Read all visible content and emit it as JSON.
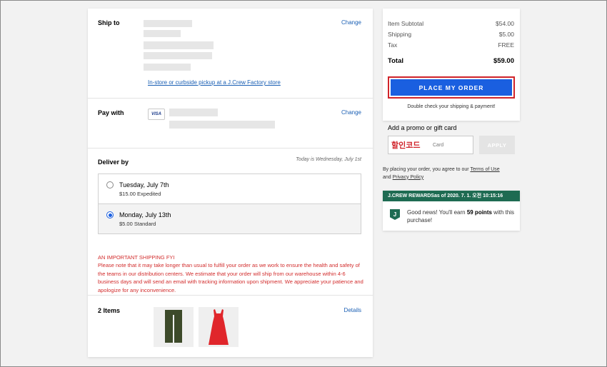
{
  "ship_to": {
    "title": "Ship to",
    "change_label": "Change",
    "pickup_link": "In-store or curbside pickup at a J.Crew Factory store"
  },
  "pay_with": {
    "title": "Pay with",
    "card_brand": "VISA",
    "change_label": "Change"
  },
  "deliver_by": {
    "title": "Deliver by",
    "today_note": "Today is Wednesday, July 1st",
    "options": [
      {
        "date": "Tuesday, July 7th",
        "detail": "$15.00 Expedited",
        "selected": false
      },
      {
        "date": "Monday, July 13th",
        "detail": "$5.00 Standard",
        "selected": true
      }
    ],
    "notice_title": "AN IMPORTANT SHIPPING FYI",
    "notice_body": "Please note that it may take longer than usual to fulfill your order as we work to ensure the health and safety of the teams in our distribution centers. We estimate that your order will ship from our warehouse within 4-6 business days and will send an email with tracking information upon shipment. We appreciate your patience and apologize for any inconvenience."
  },
  "items": {
    "title": "2 Items",
    "details_label": "Details",
    "thumbnails": [
      {
        "icon": "olive-pants-icon",
        "color": "#3d4a2a"
      },
      {
        "icon": "red-dress-icon",
        "color": "#e0262b"
      }
    ]
  },
  "summary": {
    "rows": [
      {
        "label": "Item Subtotal",
        "value": "$54.00"
      },
      {
        "label": "Shipping",
        "value": "$5.00"
      },
      {
        "label": "Tax",
        "value": "FREE"
      }
    ],
    "total_label": "Total",
    "total_value": "$59.00",
    "place_order_label": "PLACE MY ORDER",
    "double_check": "Double check your shipping & payment!"
  },
  "promo": {
    "title": "Add a promo or gift card",
    "placeholder_fragment": "Card",
    "korean_overlay": "할인코드",
    "apply_label": "APPLY"
  },
  "agreement": {
    "prefix": "By placing your order, you agree to our ",
    "terms_link": "Terms of Use",
    "and_text": "and ",
    "privacy_link": "Privacy Policy"
  },
  "rewards": {
    "header": "J.CREW REWARDSas of 2020. 7. 1. 오전 10:15:16",
    "logo_letter": "J",
    "text_prefix": "Good news! You'll earn ",
    "points": "59 points",
    "text_suffix": " with this purchase!"
  },
  "colors": {
    "accent_blue": "#1a5fe0",
    "link_blue": "#1a5fb4",
    "notice_red": "#d22c2c",
    "rewards_green": "#1e6b52"
  }
}
